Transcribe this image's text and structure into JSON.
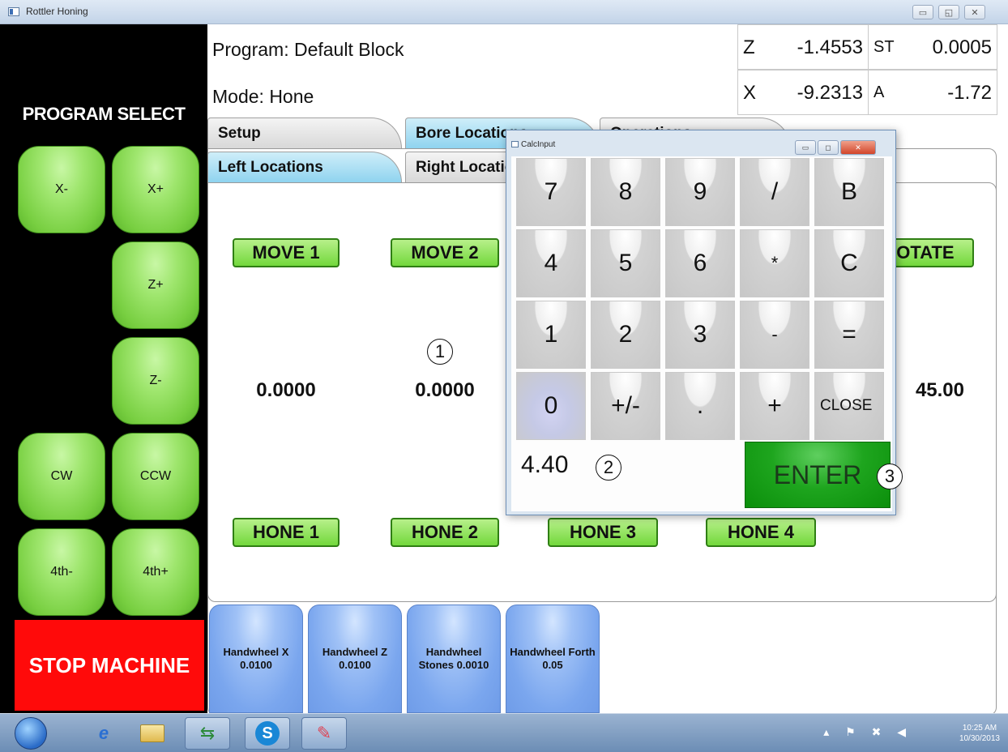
{
  "window": {
    "title": "Rottler Honing",
    "controls": [
      "▭",
      "◱",
      "✕"
    ]
  },
  "left_panel": {
    "title": "PROGRAM SELECT",
    "buttons": [
      "X-",
      "X+",
      "Z+",
      "Z-",
      "CW",
      "CCW",
      "4th-",
      "4th+"
    ],
    "stop": "STOP MACHINE"
  },
  "header": {
    "program": "Program: Default Block",
    "mode": "Mode: Hone"
  },
  "readouts": [
    {
      "label": "Z",
      "value": "-1.4553"
    },
    {
      "label": "ST",
      "value": "0.0005"
    },
    {
      "label": "X",
      "value": "-9.2313"
    },
    {
      "label": "A",
      "value": "-1.72"
    }
  ],
  "tabs_top": [
    "Setup",
    "Bore Locations",
    "Operations"
  ],
  "tabs_sub": [
    "Left Locations",
    "Right Locations"
  ],
  "move_buttons": [
    "MOVE 1",
    "MOVE 2",
    "ROTATE"
  ],
  "values": [
    "0.0000",
    "0.0000",
    "45.00"
  ],
  "hone_buttons": [
    "HONE 1",
    "HONE 2",
    "HONE 3",
    "HONE 4"
  ],
  "handwheels": [
    "Handwheel X 0.0100",
    "Handwheel Z 0.0100",
    "Handwheel Stones 0.0010",
    "Handwheel Forth 0.05"
  ],
  "calc": {
    "title": "CalcInput",
    "keys": [
      "7",
      "8",
      "9",
      "/",
      "B",
      "4",
      "5",
      "6",
      "*",
      "C",
      "1",
      "2",
      "3",
      "-",
      "=",
      "0",
      "+/-",
      ".",
      "+",
      "CLOSE"
    ],
    "display": "4.40",
    "enter": "ENTER"
  },
  "callouts": [
    "1",
    "2",
    "3"
  ],
  "taskbar": {
    "time": "10:25 AM",
    "date": "10/30/2013"
  }
}
